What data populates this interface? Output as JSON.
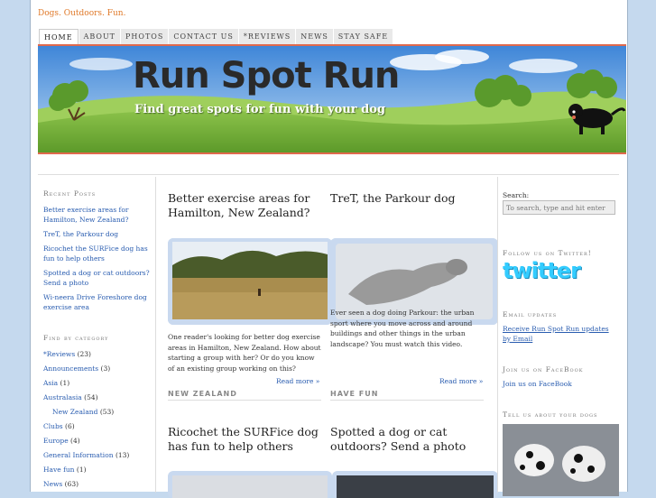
{
  "site": {
    "tagline": "Dogs. Outdoors. Fun.",
    "banner_title": "Run Spot Run",
    "banner_subtitle": "Find great spots for fun with your dog"
  },
  "nav": [
    {
      "label": "HOME",
      "active": true
    },
    {
      "label": "ABOUT"
    },
    {
      "label": "PHOTOS"
    },
    {
      "label": "CONTACT US"
    },
    {
      "label": "*REVIEWS"
    },
    {
      "label": "NEWS"
    },
    {
      "label": "STAY SAFE"
    }
  ],
  "sidebar_left": {
    "recent_heading": "Recent Posts",
    "recent_posts": [
      "Better exercise areas for Hamilton, New Zealand?",
      "TreT, the Parkour dog",
      "Ricochet the SURFice dog has fun to help others",
      "Spotted a dog or cat outdoors? Send a photo",
      "Wi-neera Drive Foreshore dog exercise area"
    ],
    "category_heading": "Find by category",
    "categories": [
      {
        "label": "*Reviews",
        "count": "(23)"
      },
      {
        "label": "Announcements",
        "count": "(3)"
      },
      {
        "label": "Asia",
        "count": "(1)"
      },
      {
        "label": "Australasia",
        "count": "(54)"
      },
      {
        "label": "New Zealand",
        "count": "(53)",
        "indent": true
      },
      {
        "label": "Clubs",
        "count": "(6)"
      },
      {
        "label": "Europe",
        "count": "(4)"
      },
      {
        "label": "General Information",
        "count": "(13)"
      },
      {
        "label": "Have fun",
        "count": "(1)"
      },
      {
        "label": "News",
        "count": "(63)"
      }
    ]
  },
  "posts": [
    {
      "title": "Better exercise areas for Hamilton, New Zealand?",
      "excerpt": "One reader's looking for better dog exercise areas in Hamilton, New Zealand. How about starting a group with her? Or do you know of an existing group working on this?",
      "read_more": "Read more »",
      "category": "NEW ZEALAND"
    },
    {
      "title": "TreT, the Parkour dog",
      "excerpt": "Ever seen a dog doing Parkour: the urban sport where you move across and around buildings and other things in the urban landscape? You must watch this video.",
      "read_more": "Read more »",
      "category": "HAVE FUN"
    },
    {
      "title": "Ricochet the SURFice dog has fun to help others"
    },
    {
      "title": "Spotted a dog or cat outdoors? Send a photo"
    }
  ],
  "sidebar_right": {
    "search_label": "Search:",
    "search_placeholder": "To search, type and hit enter",
    "twitter_heading": "Follow us on Twitter!",
    "twitter_logo": "twitter",
    "email_heading": "Email updates",
    "email_link": "Receive Run Spot Run updates by Email",
    "facebook_heading": "Join us on FaceBook",
    "facebook_link": "Join us on FaceBook",
    "dogs_heading": "Tell us about your dogs"
  },
  "colors": {
    "accent": "#e0694d",
    "link": "#2a5db0",
    "background": "#c5d9ee",
    "twitter": "#33ccff"
  }
}
